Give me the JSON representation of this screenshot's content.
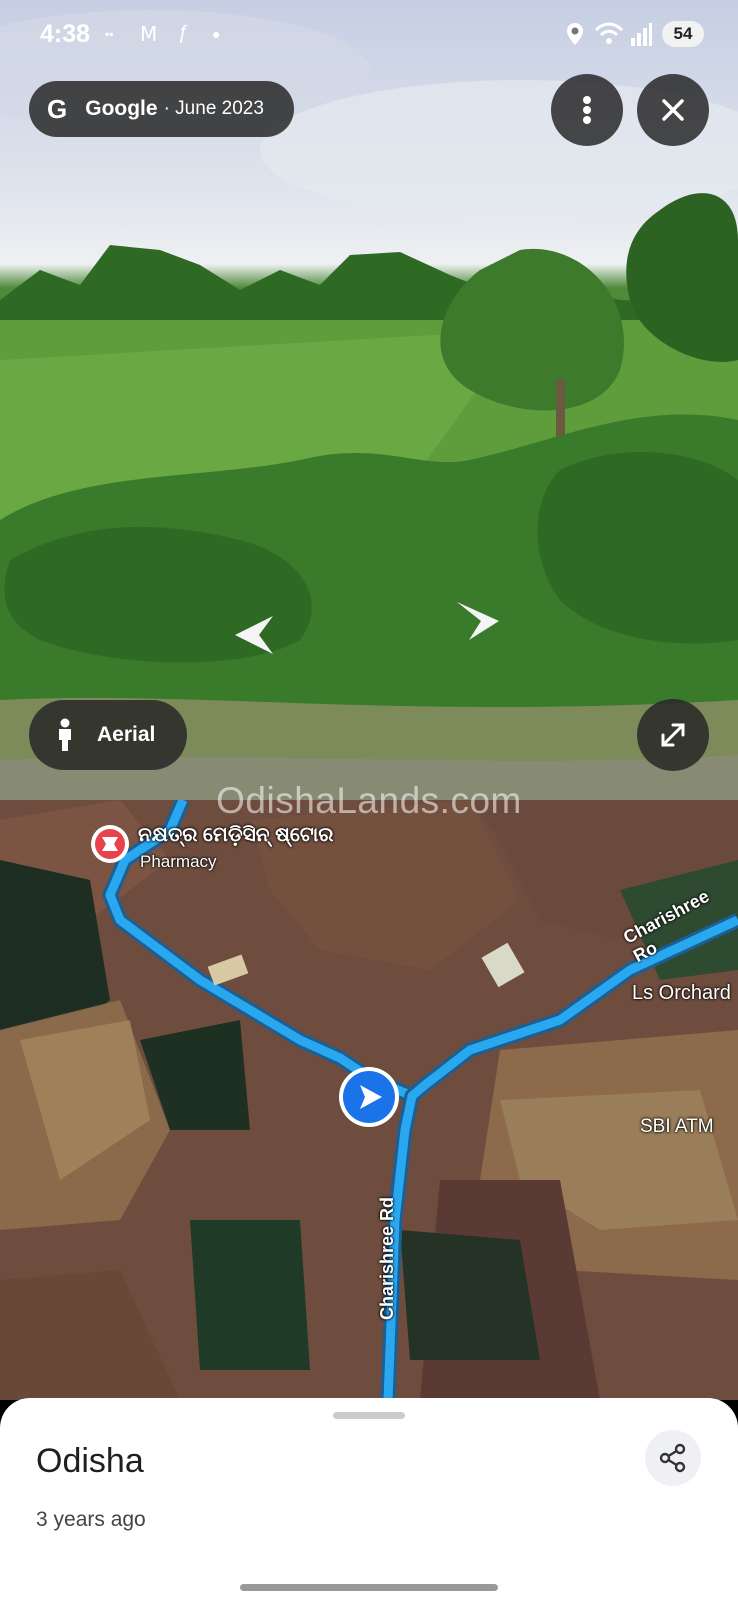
{
  "status_bar": {
    "time": "4:38",
    "battery": "54"
  },
  "street_view": {
    "provider": "Google",
    "date": "· June 2023",
    "aerial_label": "Aerial"
  },
  "map": {
    "watermark": "OdishaLands.com",
    "poi_name": "ନକ୍ଷତ୍ର ମେଡ଼ିସିନ୍ ଷ୍ଟୋର",
    "poi_category": "Pharmacy",
    "road_label": "Charishree Rd",
    "road_label_top": "Charishree Ro",
    "place_orchard": "Ls Orchard",
    "place_atm": "SBI ATM",
    "colors": {
      "route": "#29a8f0",
      "marker": "#1a73e8",
      "pharmacy": "#e8434a"
    }
  },
  "sheet": {
    "title": "Odisha",
    "subtitle": "3 years ago"
  }
}
